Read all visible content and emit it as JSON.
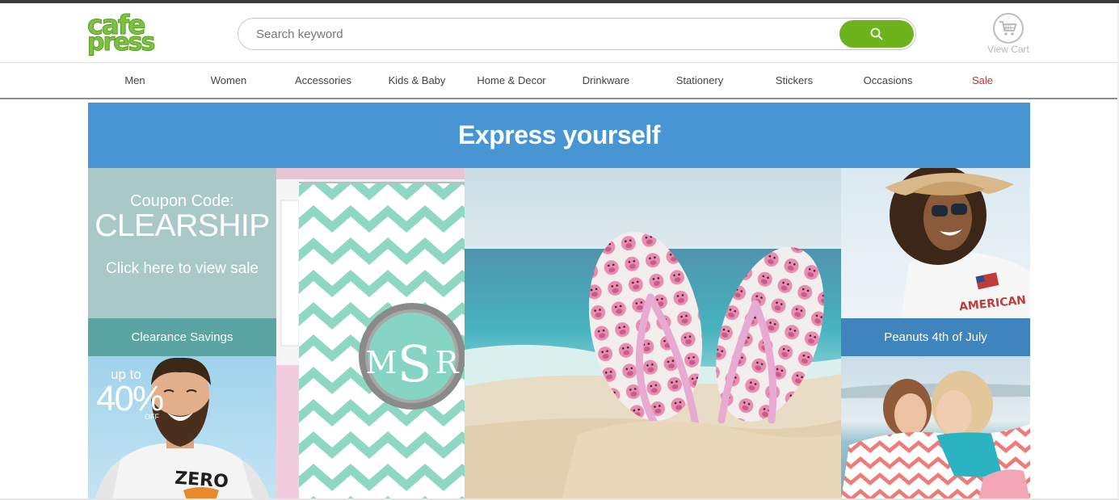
{
  "header": {
    "logo_line1": "cafe",
    "logo_line2": "press",
    "search": {
      "placeholder": "Search keyword"
    },
    "cart": {
      "label": "View Cart"
    }
  },
  "nav": {
    "items": [
      {
        "label": "Men"
      },
      {
        "label": "Women"
      },
      {
        "label": "Accessories"
      },
      {
        "label": "Kids & Baby"
      },
      {
        "label": "Home & Decor"
      },
      {
        "label": "Drinkware"
      },
      {
        "label": "Stationery"
      },
      {
        "label": "Stickers"
      },
      {
        "label": "Occasions"
      },
      {
        "label": "Sale"
      }
    ]
  },
  "banner": {
    "title": "Express yourself"
  },
  "promos": {
    "coupon": {
      "line1": "Coupon Code:",
      "code": "CLEARSHIP",
      "cta": "Click here to view sale",
      "caption": "Clearance Savings"
    },
    "discount": {
      "up_to": "up to",
      "percent": "40%",
      "off": "OFF"
    },
    "tee_print": "ZERO",
    "monogram": {
      "left": "M",
      "center": "S",
      "right": "R"
    },
    "peanuts": {
      "caption": "Peanuts 4th of July",
      "shirt_text": "AMERICAN"
    }
  },
  "colors": {
    "brand_green": "#7cc242",
    "search_button": "#6db31c",
    "banner_blue": "#4795d3",
    "sale_red": "#d62a2a",
    "clearance_teal": "#5aa4a3",
    "peanuts_blue": "#3f84bd"
  },
  "icons": {
    "search_button": "search-icon",
    "cart": "shopping-cart-icon"
  }
}
